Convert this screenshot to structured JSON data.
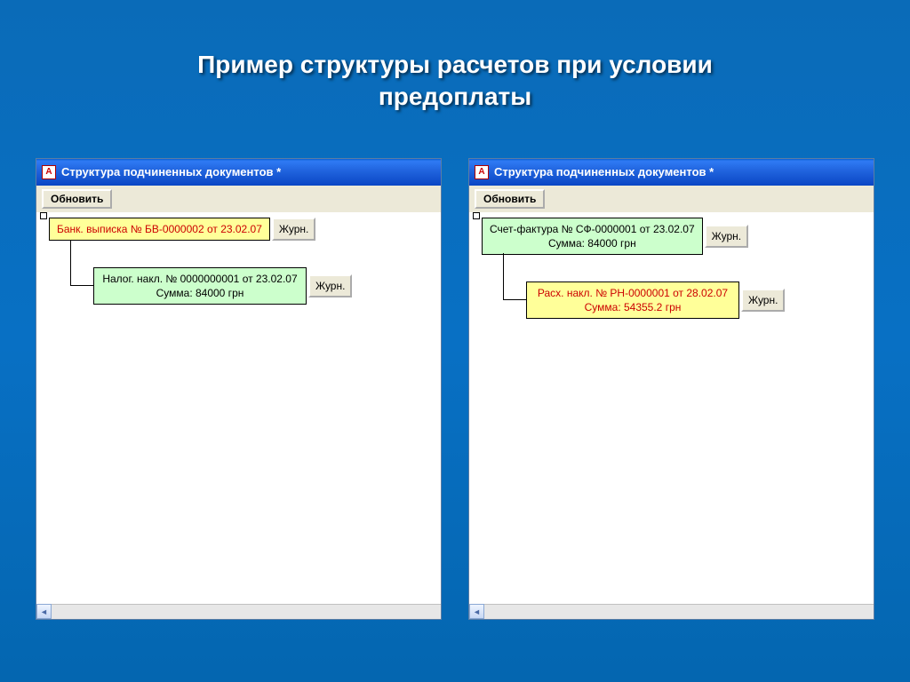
{
  "slide": {
    "title_line1": "Пример структуры расчетов при условии",
    "title_line2": "предоплаты"
  },
  "window": {
    "title": "Структура подчиненных документов  *",
    "refresh_label": "Обновить",
    "journal_label": "Журн.",
    "icon_glyph": "A"
  },
  "left_window": {
    "doc1": {
      "line1": "Банк. выписка № БВ-0000002 от 23.02.07"
    },
    "doc2": {
      "line1": "Налог. накл. № 0000000001 от 23.02.07",
      "line2": "Сумма: 84000 грн"
    }
  },
  "right_window": {
    "doc1": {
      "line1": "Счет-фактура № СФ-0000001 от 23.02.07",
      "line2": "Сумма: 84000 грн"
    },
    "doc2": {
      "line1": "Расх. накл. № РН-0000001 от 28.02.07",
      "line2": "Сумма: 54355.2 грн"
    }
  },
  "scrollbar": {
    "left_arrow": "◄"
  }
}
